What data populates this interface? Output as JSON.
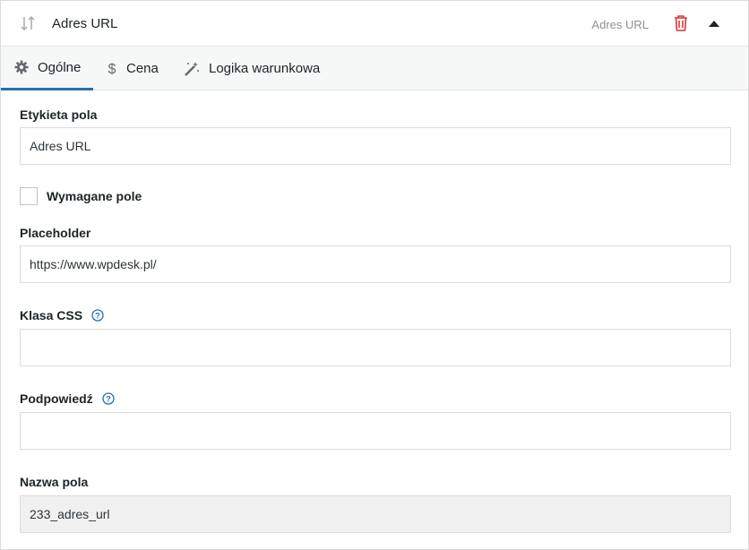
{
  "header": {
    "title": "Adres URL",
    "field_type": "Adres URL"
  },
  "tabs": [
    {
      "label": "Ogólne",
      "icon": "gear-icon",
      "active": true
    },
    {
      "label": "Cena",
      "icon": "dollar-icon",
      "active": false
    },
    {
      "label": "Logika warunkowa",
      "icon": "magic-wand-icon",
      "active": false
    }
  ],
  "fields": {
    "label_field": {
      "label": "Etykieta pola",
      "value": "Adres URL"
    },
    "required": {
      "label": "Wymagane pole",
      "checked": false
    },
    "placeholder": {
      "label": "Placeholder",
      "value": "https://www.wpdesk.pl/"
    },
    "css_class": {
      "label": "Klasa CSS",
      "value": ""
    },
    "tooltip": {
      "label": "Podpowiedź",
      "value": ""
    },
    "name": {
      "label": "Nazwa pola",
      "value": "233_adres_url"
    }
  },
  "colors": {
    "accent": "#2271b1",
    "danger": "#d63638",
    "muted": "#8c8f94"
  }
}
